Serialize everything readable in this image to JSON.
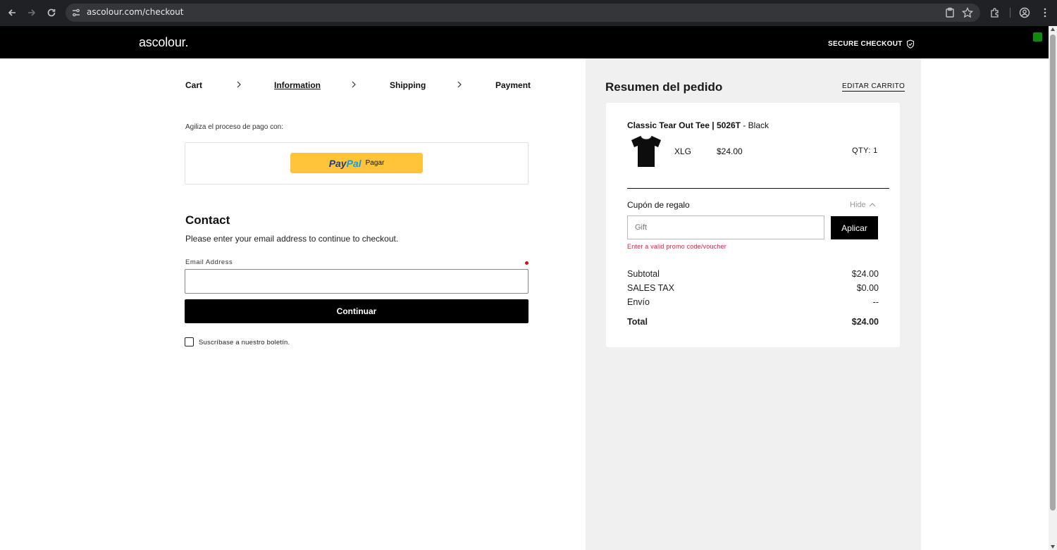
{
  "browser": {
    "url": "ascolour.com/checkout",
    "icons": [
      "back-icon",
      "forward-icon",
      "reload-icon",
      "site-settings-icon",
      "clipboard-icon",
      "star-icon",
      "extensions-icon",
      "profile-icon",
      "menu-icon"
    ]
  },
  "header": {
    "logo": "ascolour.",
    "secure_label": "SECURE CHECKOUT",
    "secure_icon": "shield-check-icon"
  },
  "breadcrumb": {
    "steps": [
      {
        "label": "Cart"
      },
      {
        "label": "Information",
        "active": true
      },
      {
        "label": "Shipping"
      },
      {
        "label": "Payment"
      }
    ]
  },
  "express": {
    "label": "Agiliza el proceso de pago con:",
    "paypal_part1": "Pay",
    "paypal_part2": "Pal",
    "paypal_action": "Pagar"
  },
  "contact": {
    "title": "Contact",
    "subtitle": "Please enter your email address to continue to checkout.",
    "email_label": "Email Address",
    "email_value": "",
    "continue_label": "Continuar",
    "newsletter_label": "Suscríbase a nuestro boletín.",
    "newsletter_checked": false
  },
  "summary": {
    "title": "Resumen del pedido",
    "edit_cart": "EDITAR CARRITO",
    "item": {
      "name": "Classic Tear Out Tee | 5026T",
      "color": " - Black",
      "size": "XLG",
      "price": "$24.00",
      "qty": "QTY: 1"
    },
    "coupon": {
      "label": "Cupón de regalo",
      "toggle": "Hide",
      "placeholder": "Gift",
      "apply": "Aplicar",
      "error": "Enter a valid promo code/voucher"
    },
    "totals": [
      {
        "label": "Subtotal",
        "value": "$24.00"
      },
      {
        "label": "SALES TAX",
        "value": "$0.00"
      },
      {
        "label": "Envío",
        "value": "--"
      },
      {
        "label": "Total",
        "value": "$24.00"
      }
    ]
  },
  "colors": {
    "header_bg": "#000000",
    "paypal_yellow": "#ffc439",
    "error_red": "#d2283c",
    "summary_bg": "#f0f0f0"
  }
}
